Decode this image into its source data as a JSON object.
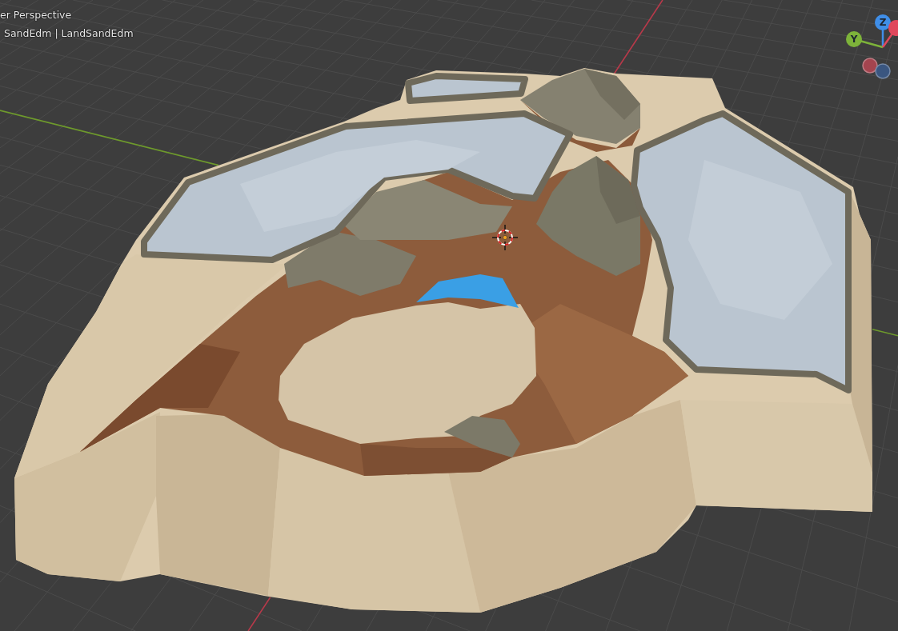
{
  "viewport": {
    "view_label": "er Perspective",
    "object_label": "SandEdm | LandSandEdm"
  },
  "gizmo": {
    "axes": [
      {
        "kind": "negative",
        "color": "#a4444f"
      },
      {
        "kind": "negative",
        "color": "#3a5680"
      },
      {
        "kind": "positive",
        "label": "Z",
        "color": "#3f8ee8"
      },
      {
        "kind": "positive",
        "label": "Y",
        "color": "#7db33a"
      },
      {
        "kind": "positive",
        "color": "#e0485c"
      }
    ]
  }
}
